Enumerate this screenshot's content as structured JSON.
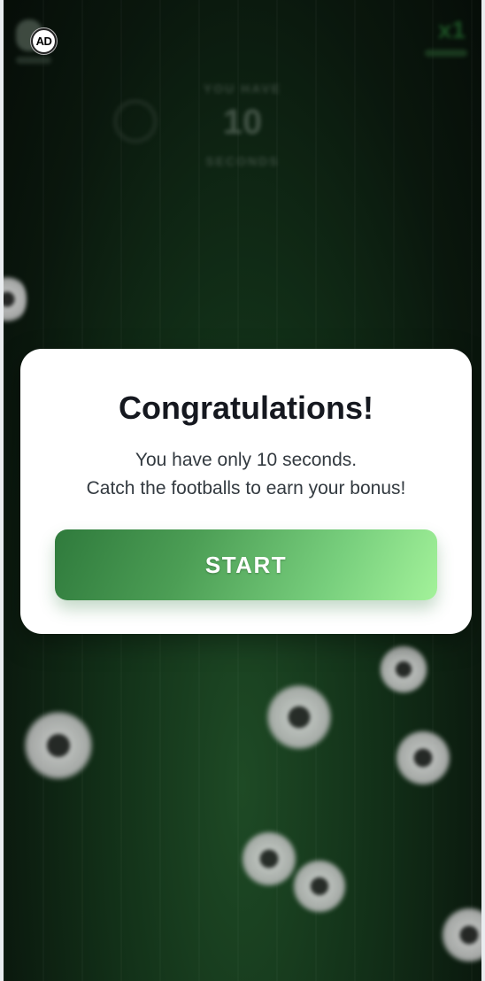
{
  "ad_badge": {
    "label": "AD"
  },
  "hud": {
    "multiplier": "x1",
    "caption_top": "YOU HAVE",
    "seconds": "10",
    "caption_bottom": "SECONDS"
  },
  "modal": {
    "title": "Congratulations!",
    "line1": "You have only 10 seconds.",
    "line2": "Catch the footballs to earn your bonus!",
    "start_label": "START"
  },
  "colors": {
    "accent_start": "#2f7a3c",
    "accent_end": "#a3f29a",
    "background": "#0a170d"
  },
  "icons": {
    "ball": "football-icon",
    "timer": "timer-ring-icon",
    "avatar": "avatar-icon"
  }
}
